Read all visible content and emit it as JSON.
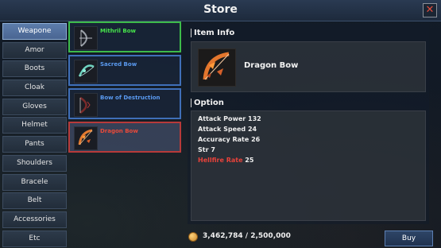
{
  "window": {
    "title": "Store",
    "close_icon": "close-icon"
  },
  "categories": [
    {
      "label": "Weapone",
      "active": true
    },
    {
      "label": "Amor",
      "active": false
    },
    {
      "label": "Boots",
      "active": false
    },
    {
      "label": "Cloak",
      "active": false
    },
    {
      "label": "Gloves",
      "active": false
    },
    {
      "label": "Helmet",
      "active": false
    },
    {
      "label": "Pants",
      "active": false
    },
    {
      "label": "Shoulders",
      "active": false
    },
    {
      "label": "Bracele",
      "active": false
    },
    {
      "label": "Belt",
      "active": false
    },
    {
      "label": "Accessories",
      "active": false
    },
    {
      "label": "Etc",
      "active": false
    }
  ],
  "items": [
    {
      "name": "Mithril Bow",
      "rarity_color": "#46e34b",
      "icon": "mithril-bow-icon"
    },
    {
      "name": "Sacred Bow",
      "rarity_color": "#5a9af0",
      "icon": "sacred-bow-icon"
    },
    {
      "name": "Bow of Destruction",
      "rarity_color": "#5a9af0",
      "icon": "destruction-bow-icon"
    },
    {
      "name": "Dragon Bow",
      "rarity_color": "#e84a3a",
      "icon": "dragon-bow-icon",
      "selected": true
    }
  ],
  "item_info": {
    "heading": "Item Info",
    "name": "Dragon Bow",
    "icon": "dragon-bow-icon"
  },
  "option": {
    "heading": "Option",
    "stats": [
      {
        "label": "Attack Power",
        "value": "132"
      },
      {
        "label": "Attack Speed",
        "value": "24"
      },
      {
        "label": "Accuracy Rate",
        "value": "26"
      },
      {
        "label": "Str",
        "value": "7"
      },
      {
        "label": "Hellfire Rate",
        "value": "25",
        "highlight": "#e8423a"
      }
    ]
  },
  "footer": {
    "gold": "3,462,784 / 2,500,000",
    "coin_icon": "gold-coin-icon",
    "buy_label": "Buy"
  }
}
